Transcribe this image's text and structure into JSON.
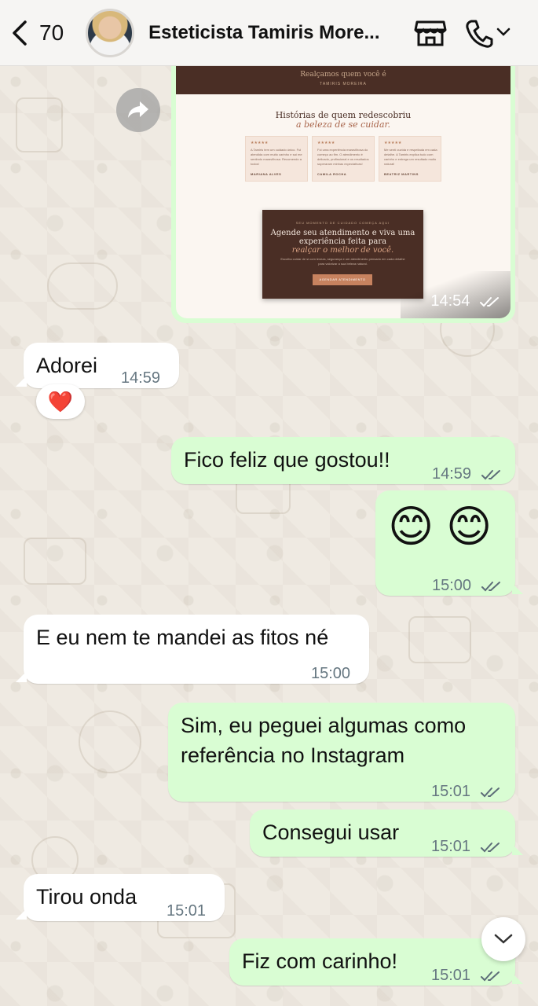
{
  "header": {
    "unread_count": "70",
    "contact_name": "Esteticista Tamiris More..."
  },
  "image_message": {
    "preview": {
      "top_band_title": "Realçamos quem você é",
      "top_band_name": "TAMIRIS MOREIRA",
      "section_title": "Histórias de quem redescobriu",
      "section_subtitle": "a beleza de se cuidar.",
      "testimonials": [
        {
          "stars": "★★★★★",
          "text": "A Tamiris tem um cuidado único. Fui atendida com muito carinho e saí me sentindo maravilhosa. Recomendo a todos!",
          "author": "MARIANA ALVES"
        },
        {
          "stars": "★★★★★",
          "text": "Foi uma experiência maravilhosa do começo ao fim. O atendimento é delicado, profissional e os resultados superaram minhas expectativas!",
          "author": "CAMILA ROCHA"
        },
        {
          "stars": "★★★★★",
          "text": "Me senti ouvida e respeitada em cada detalhe. A Tamiris explica tudo com carinho e entrega um resultado muito natural!",
          "author": "BEATRIZ MARTINS"
        }
      ],
      "cta_kicker": "SEU MOMENTO DE CUIDADO COMEÇA AQUI",
      "cta_heading": "Agende seu atendimento e viva uma experiência feita para",
      "cta_heading_em": "realçar o melhor de você.",
      "cta_paragraph": "Escolha cuidar de si com leveza, segurança e um atendimento pensado em cada detalhe para valorizar a sua beleza natural.",
      "cta_button": "AGENDAR ATENDIMENTO"
    },
    "time": "14:54"
  },
  "messages": [
    {
      "dir": "in",
      "text": "Adorei",
      "time": "14:59",
      "reaction": "❤️"
    },
    {
      "dir": "out",
      "text": "Fico feliz que gostou!!",
      "time": "14:59"
    },
    {
      "dir": "out",
      "text": "😊 😊",
      "time": "15:00"
    },
    {
      "dir": "in",
      "text": "E eu nem te mandei as fitos né",
      "time": "15:00"
    },
    {
      "dir": "out",
      "text_line1": "Sim, eu peguei algumas como",
      "text_line2": "referência no Instagram",
      "time": "15:01"
    },
    {
      "dir": "out",
      "text": "Consegui usar",
      "time": "15:01"
    },
    {
      "dir": "in",
      "text": "Tirou onda",
      "time": "15:01"
    },
    {
      "dir": "out",
      "text": "Fiz com carinho!",
      "time": "15:01"
    }
  ],
  "icons": {
    "back": "chevron-left-icon",
    "store": "storefront-icon",
    "call": "phone-icon",
    "call_menu": "chevron-down-icon",
    "forward": "forward-icon",
    "read_receipt": "double-check-icon",
    "scroll": "chevron-down-icon"
  },
  "colors": {
    "outgoing_bubble": "#d9fdd3",
    "incoming_bubble": "#ffffff",
    "wallpaper": "#efeae2",
    "timestamp": "#667781"
  }
}
